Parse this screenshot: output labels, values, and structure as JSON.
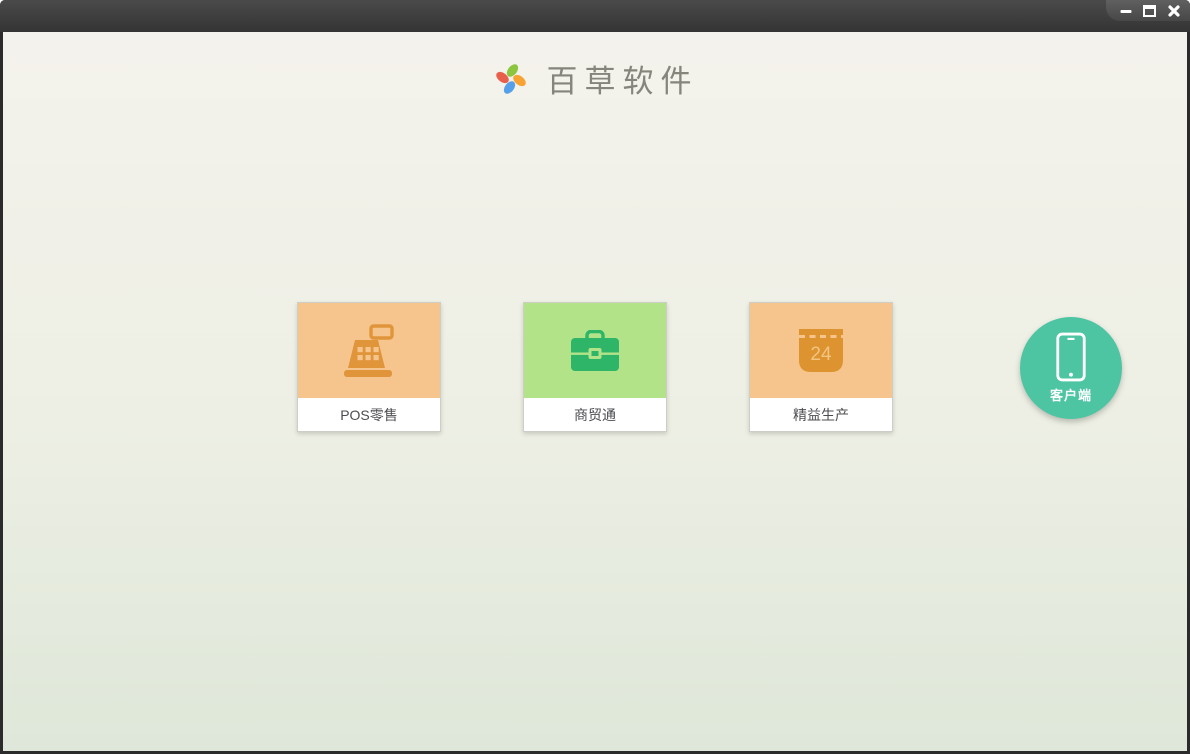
{
  "window": {
    "controls": [
      {
        "name": "minimize"
      },
      {
        "name": "maximize"
      },
      {
        "name": "close"
      }
    ]
  },
  "header": {
    "app_title": "百草软件",
    "logo_icon": "pinwheel-logo",
    "logo_colors": {
      "top": "#8cc63f",
      "right": "#f7a231",
      "bottom": "#55a0e8",
      "left": "#e8604c"
    }
  },
  "products": [
    {
      "label": "POS零售",
      "icon": "cash-register-icon",
      "tile_color": "#f6c58d",
      "icon_color": "#e0953a"
    },
    {
      "label": "商贸通",
      "icon": "briefcase-icon",
      "tile_color": "#b2e389",
      "icon_color": "#2fb567"
    },
    {
      "label": "精益生产",
      "icon": "calendar-icon",
      "tile_color": "#f6c58d",
      "icon_color": "#dd9330",
      "calendar_day": "24"
    }
  ],
  "client_button": {
    "label": "客户端",
    "icon": "smartphone-icon",
    "color": "#4dc5a2"
  },
  "colors": {
    "titlebar": "#3c3c3c",
    "bg_top": "#f4f2ec",
    "bg_bottom": "#dee7d9",
    "card_text": "#4c4d51",
    "title_text": "#85857c"
  }
}
